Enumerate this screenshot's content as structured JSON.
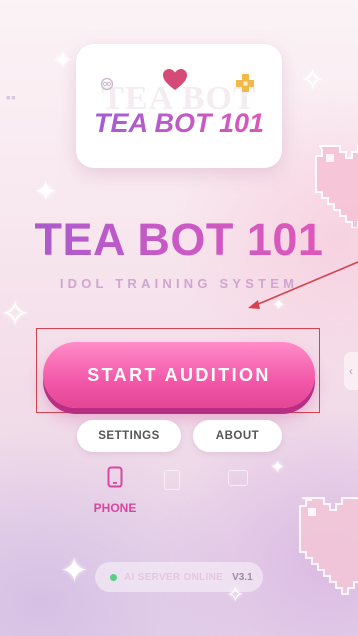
{
  "logo_card": {
    "ghost_text": "TEA BOT",
    "title": "TEA BOT 101"
  },
  "main": {
    "title": "TEA BOT 101",
    "subtitle": "IDOL TRAINING SYSTEM",
    "start_label": "START AUDITION"
  },
  "menu": {
    "settings_label": "SETTINGS",
    "about_label": "ABOUT"
  },
  "device": {
    "phone_label": "PHONE"
  },
  "status": {
    "server_text": "AI SERVER ONLINE",
    "version": "V3.1"
  },
  "colors": {
    "accent_pink": "#f357a8",
    "title_purple": "#a45ad0",
    "highlight_red": "#d6424d",
    "online_green": "#58cf7e"
  },
  "icons": [
    "heart-icon",
    "ring-icon",
    "cross-icon",
    "phone-icon",
    "sparkle-icon",
    "pixel-heart-icon"
  ]
}
